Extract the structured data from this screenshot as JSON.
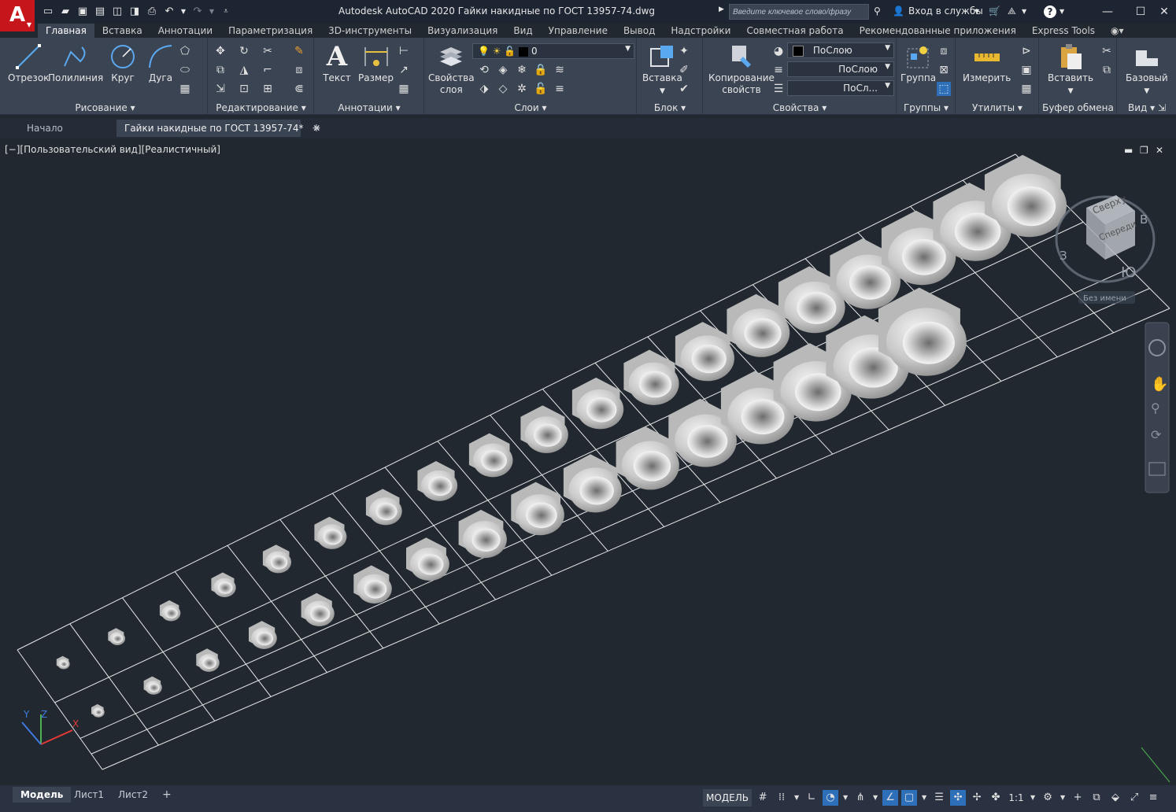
{
  "app": {
    "logo_letter": "A",
    "title": "Autodesk AutoCAD 2020    Гайки накидные по ГОСТ 13957-74.dwg",
    "search_placeholder": "Введите ключевое слово/фразу",
    "signin": "Вход в службы",
    "help": "?"
  },
  "ribbon_tabs": [
    "Главная",
    "Вставка",
    "Аннотации",
    "Параметризация",
    "3D-инструменты",
    "Визуализация",
    "Вид",
    "Управление",
    "Вывод",
    "Надстройки",
    "Совместная работа",
    "Рекомендованные приложения",
    "Express Tools"
  ],
  "panels": {
    "draw": {
      "title": "Рисование",
      "line": "Отрезок",
      "polyline": "Полилиния",
      "circle": "Круг",
      "arc": "Дуга"
    },
    "modify": {
      "title": "Редактирование"
    },
    "annotation": {
      "title": "Аннотации",
      "text": "Текст",
      "dimension": "Размер"
    },
    "layers": {
      "title": "Слои",
      "props_line1": "Свойства",
      "props_line2": "слоя",
      "current_layer": "0"
    },
    "block": {
      "title": "Блок",
      "insert": "Вставка"
    },
    "properties": {
      "title": "Свойства",
      "match_line1": "Копирование",
      "match_line2": "свойств",
      "color": "ПоСлою",
      "lineweight": "ПоСлою",
      "linetype": "ПоСл..."
    },
    "groups": {
      "title": "Группы",
      "group": "Группа"
    },
    "utilities": {
      "title": "Утилиты",
      "measure": "Измерить"
    },
    "clipboard": {
      "title": "Буфер обмена",
      "paste": "Вставить"
    },
    "view": {
      "title": "Вид",
      "base": "Базовый"
    }
  },
  "file_tabs": {
    "start": "Начало",
    "active": "Гайки накидные по ГОСТ 13957-74*"
  },
  "viewport": {
    "label": "[−][Пользовательский вид][Реалистичный]",
    "viewcube": {
      "top": "Сверху",
      "front": "Спереди",
      "east": "В",
      "west": "З",
      "south": "Ю",
      "wcs": "Без имени"
    },
    "ucs": {
      "x": "X",
      "y": "Y",
      "z": "Z"
    }
  },
  "layout_tabs": [
    "Модель",
    "Лист1",
    "Лист2"
  ],
  "status": {
    "model": "МОДЕЛЬ",
    "scale": "1:1"
  },
  "colors": {
    "accent": "#2d6fb8",
    "logo_red": "#c7161b",
    "viewport_bg": "#212830",
    "ribbon_bg": "#3b4453"
  }
}
